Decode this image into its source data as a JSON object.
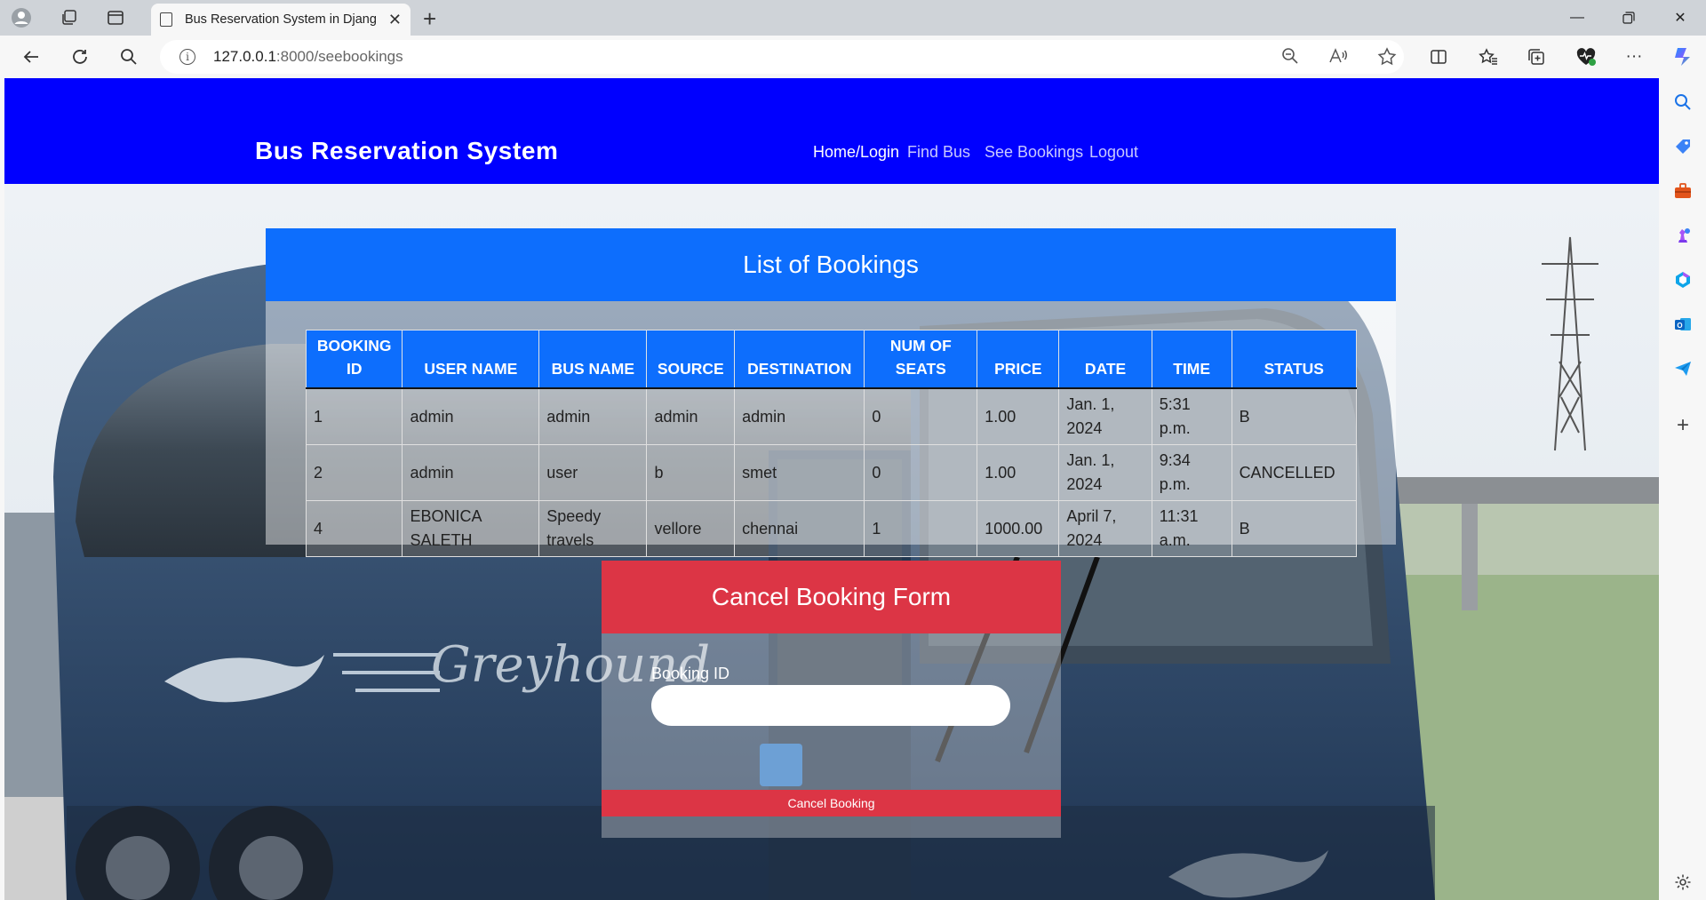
{
  "browser": {
    "tab_title": "Bus Reservation System in Djang",
    "url_host": "127.0.0.1",
    "url_path": ":8000/seebookings"
  },
  "navbar": {
    "brand": "Bus Reservation System",
    "links": [
      "Home/Login",
      "Find Bus",
      "See Bookings",
      "Logout"
    ]
  },
  "bookings": {
    "title": "List of Bookings",
    "columns": [
      "BOOKING ID",
      "USER NAME",
      "BUS NAME",
      "SOURCE",
      "DESTINATION",
      "NUM OF SEATS",
      "PRICE",
      "DATE",
      "TIME",
      "STATUS"
    ],
    "rows": [
      [
        "1",
        "admin",
        "admin",
        "admin",
        "admin",
        "0",
        "1.00",
        "Jan. 1, 2024",
        "5:31 p.m.",
        "B"
      ],
      [
        "2",
        "admin",
        "user",
        "b",
        "smet",
        "0",
        "1.00",
        "Jan. 1, 2024",
        "9:34 p.m.",
        "CANCELLED"
      ],
      [
        "4",
        "EBONICA SALETH",
        "Speedy travels",
        "vellore",
        "chennai",
        "1",
        "1000.00",
        "April 7, 2024",
        "11:31 a.m.",
        "B"
      ]
    ]
  },
  "cancel_form": {
    "title": "Cancel Booking Form",
    "field_label": "Booking ID",
    "field_value": "",
    "button_label": "Cancel Booking"
  },
  "colors": {
    "navbar": "#0000ff",
    "primary": "#0d6efd",
    "danger": "#dc3545"
  }
}
